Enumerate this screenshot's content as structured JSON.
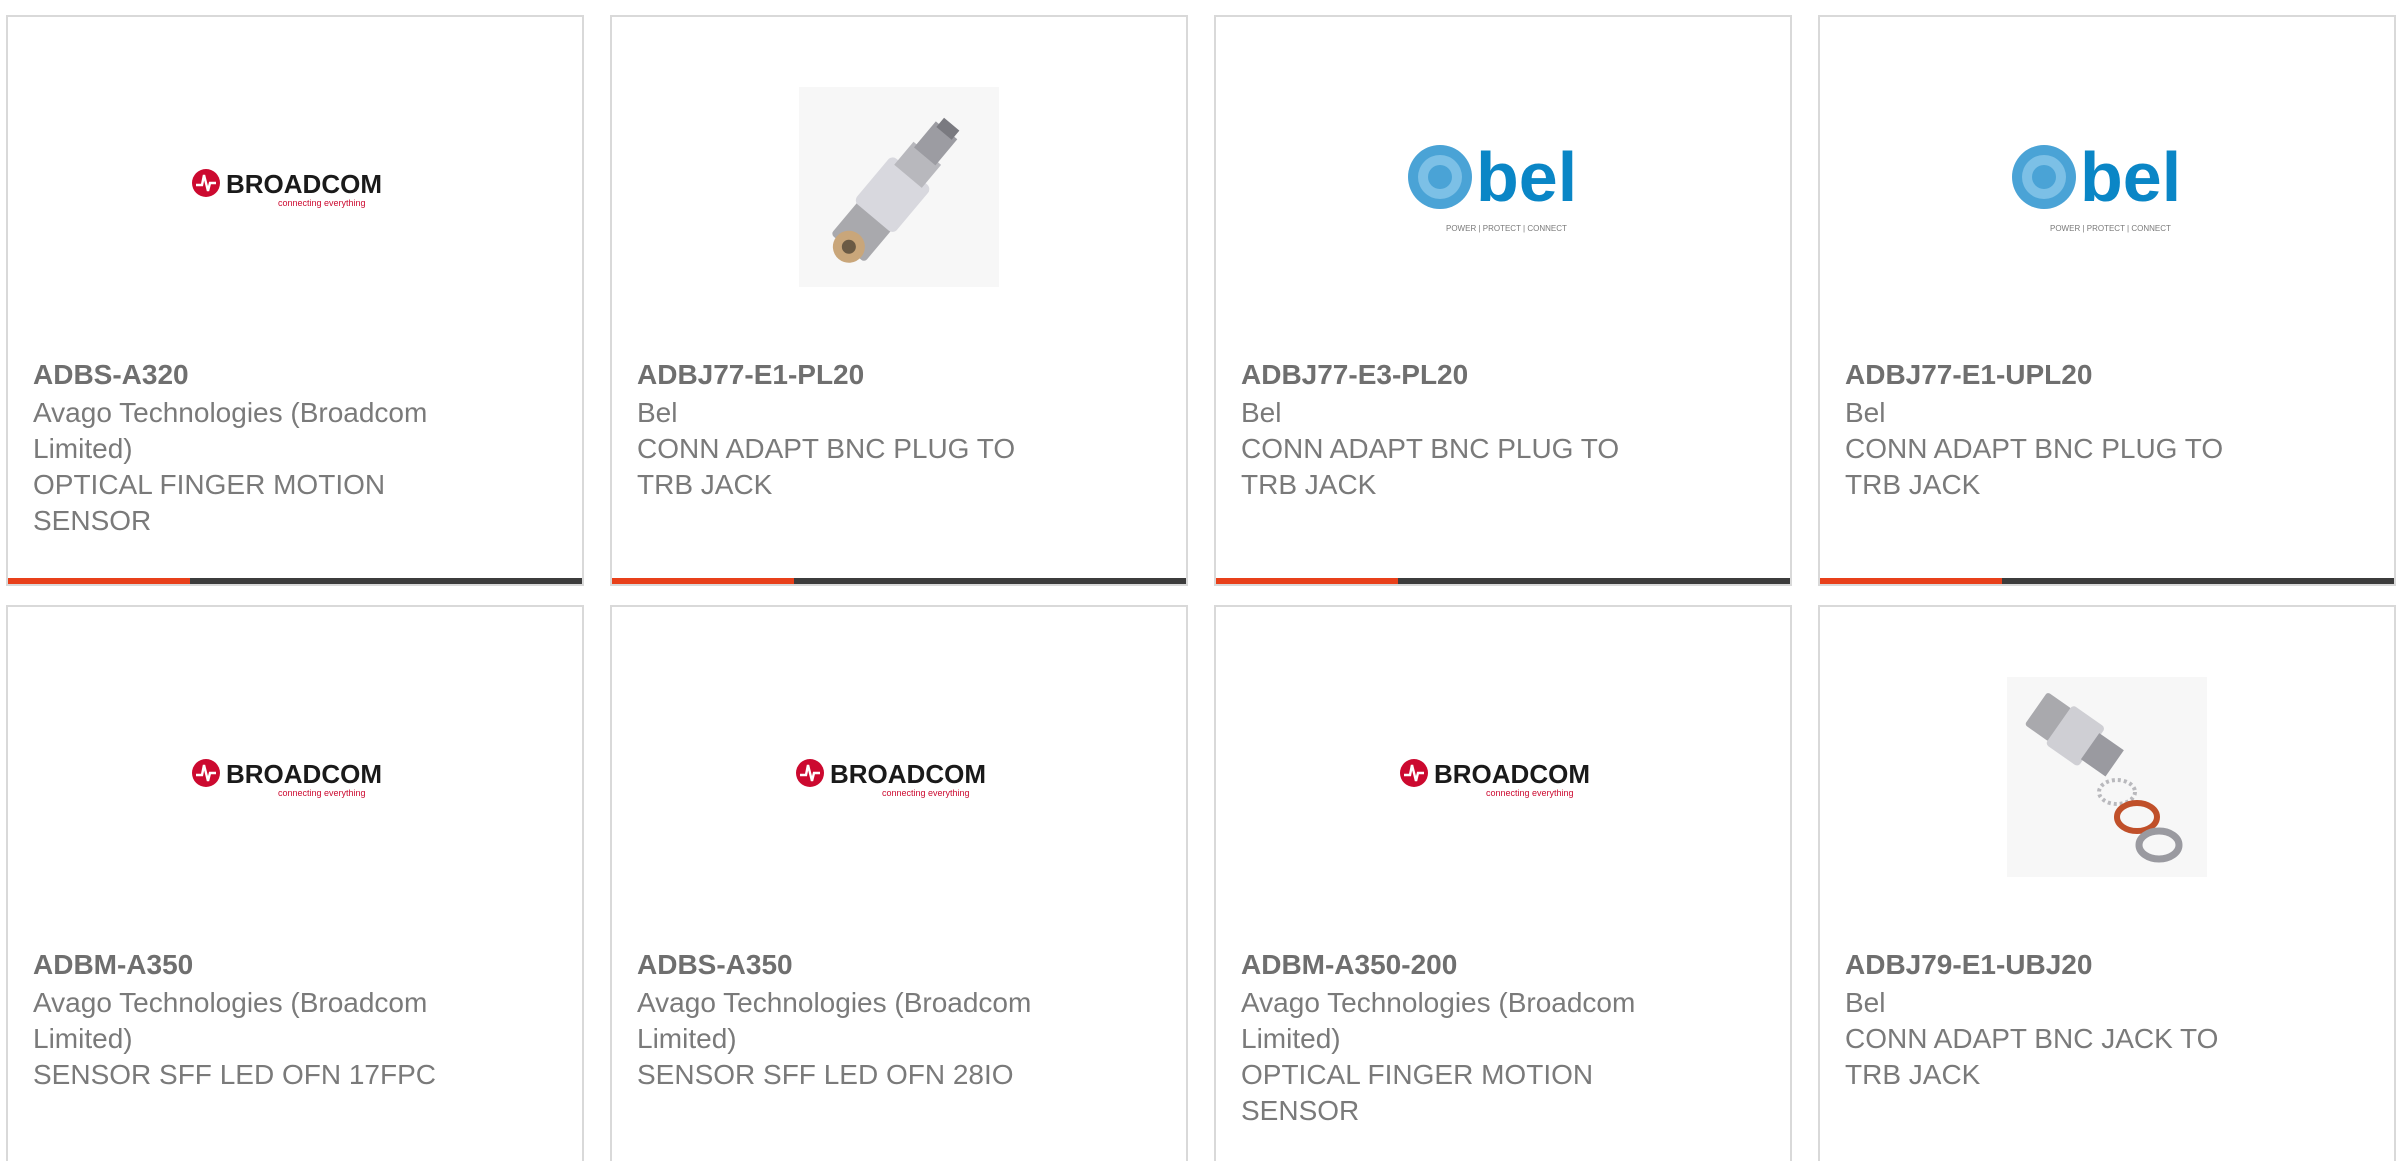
{
  "products": [
    {
      "part_number": "ADBS-A320",
      "manufacturer": "Avago Technologies (Broadcom Limited)",
      "description": "OPTICAL FINGER MOTION SENSOR",
      "image": "broadcom-logo"
    },
    {
      "part_number": "ADBJ77-E1-PL20",
      "manufacturer": "Bel",
      "description": "CONN ADAPT BNC PLUG TO TRB JACK",
      "image": "bnc-adapter-photo"
    },
    {
      "part_number": "ADBJ77-E3-PL20",
      "manufacturer": "Bel",
      "description": "CONN ADAPT BNC PLUG TO TRB JACK",
      "image": "bel-logo"
    },
    {
      "part_number": "ADBJ77-E1-UPL20",
      "manufacturer": "Bel",
      "description": "CONN ADAPT BNC PLUG TO TRB JACK",
      "image": "bel-logo"
    },
    {
      "part_number": "ADBM-A350",
      "manufacturer": "Avago Technologies (Broadcom Limited)",
      "description": "SENSOR SFF LED OFN 17FPC",
      "image": "broadcom-logo"
    },
    {
      "part_number": "ADBS-A350",
      "manufacturer": "Avago Technologies (Broadcom Limited)",
      "description": "SENSOR SFF LED OFN 28IO",
      "image": "broadcom-logo"
    },
    {
      "part_number": "ADBM-A350-200",
      "manufacturer": "Avago Technologies (Broadcom Limited)",
      "description": "OPTICAL FINGER MOTION SENSOR",
      "image": "broadcom-logo"
    },
    {
      "part_number": "ADBJ79-E1-UBJ20",
      "manufacturer": "Bel",
      "description": "CONN ADAPT BNC JACK TO TRB JACK",
      "image": "bnc-jack-kit-photo"
    }
  ],
  "logos": {
    "broadcom_text": "BROADCOM",
    "broadcom_tagline": "connecting everything",
    "bel_text": "bel",
    "bel_tagline": "POWER | PROTECT | CONNECT"
  },
  "colors": {
    "accent": "#e8401a",
    "bar": "#3c3c3c",
    "broadcom_red": "#cc092f",
    "bel_blue": "#0a86c6"
  }
}
